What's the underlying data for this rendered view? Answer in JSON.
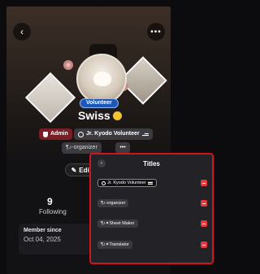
{
  "header": {
    "back_icon": "chevron-left-icon",
    "back_glyph": "‹",
    "more_icon": "more-horizontal-icon",
    "more_glyph": "•••"
  },
  "profile": {
    "role_badge": "Volunteer",
    "name": "Swiss",
    "edit_label": "Edit",
    "edit_icon": "pencil-icon",
    "edit_glyph": "✎",
    "more_chip_glyph": "•••",
    "colors": {
      "role_badge": "#1b58b8",
      "admin_chip": "#7b1d24"
    }
  },
  "chips": {
    "admin": "Admin",
    "kyodo": "Jr. Kyodo Volunteer",
    "organizer": "¶♪-organizer"
  },
  "stats": {
    "following_count": "9",
    "following_label": "Following"
  },
  "member": {
    "label": "Member since",
    "date": "Oct 04, 2025"
  },
  "titles_modal": {
    "title": "Titles",
    "close_glyph": "‹",
    "accent_color": "#d0161d",
    "remove_color": "#e6383f",
    "items": [
      {
        "label": "Jr. Kyodo Volunteer"
      },
      {
        "label": "¶♪-organizer"
      },
      {
        "label": "¶♪✦Sheet Maker"
      },
      {
        "label": "¶♪✦Translator"
      }
    ]
  }
}
